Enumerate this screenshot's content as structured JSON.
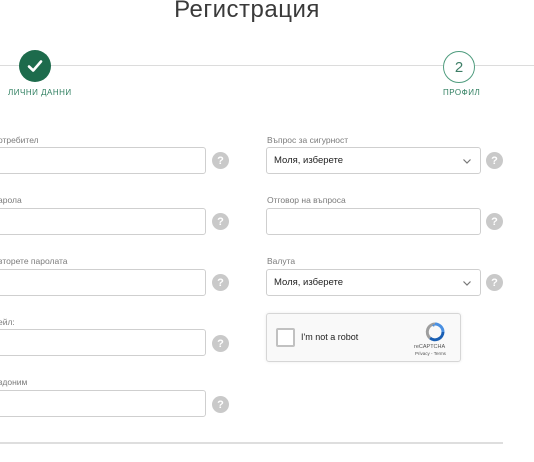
{
  "page": {
    "title": "Регистрация"
  },
  "stepper": {
    "steps": [
      {
        "label": "ЛИЧНИ ДАННИ",
        "number": "",
        "status": "completed",
        "icon": "check-icon"
      },
      {
        "label": "ПРОФИЛ",
        "number": "2",
        "status": "pending"
      }
    ],
    "colors": {
      "completed": "#1d6b4c",
      "pending_border": "#4f9c7e"
    }
  },
  "form": {
    "left_fields": [
      {
        "label": "отребител",
        "value": "",
        "type": "text"
      },
      {
        "label": "арола",
        "value": "",
        "type": "password"
      },
      {
        "label": "вторете паролата",
        "value": "",
        "type": "password"
      },
      {
        "label": "ейл:",
        "value": "",
        "type": "email"
      },
      {
        "label": "вдоним",
        "value": "",
        "type": "text"
      }
    ],
    "security_question": {
      "label": "Въпрос за сигурност",
      "selected": "Моля, изберете"
    },
    "security_answer": {
      "label": "Отговор на въпроса",
      "value": ""
    },
    "currency": {
      "label": "Валута",
      "selected": "Моля, изберете"
    },
    "help_icon": "question-mark-icon"
  },
  "captcha": {
    "text": "I'm not a robot",
    "brand": "reCAPTCHA",
    "privacy": "Privacy",
    "separator": " - ",
    "terms": "Terms",
    "icon": "recaptcha-logo-icon"
  }
}
